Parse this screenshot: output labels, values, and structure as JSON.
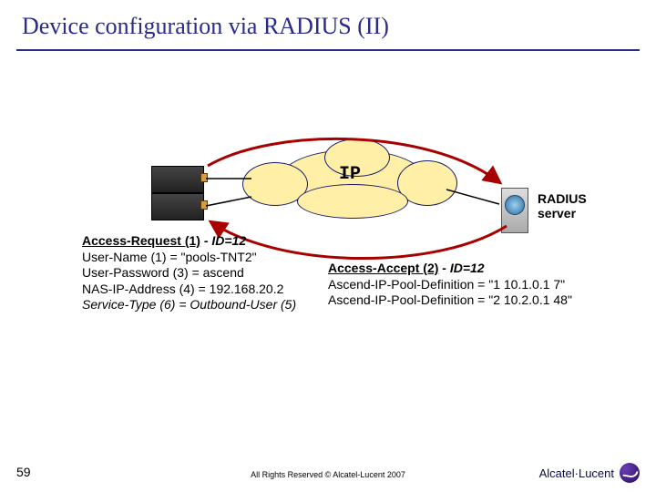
{
  "title": "Device configuration via RADIUS (II)",
  "cloud_label": "IP",
  "server_label": "RADIUS\nserver",
  "request": {
    "header_main": "Access-Request (1)",
    "header_id": " - ID=12",
    "lines": [
      "User-Name (1) = \"pools-TNT2\"",
      "User-Password (3) = ascend",
      "NAS-IP-Address (4) = 192.168.20.2",
      "Service-Type (6) = Outbound-User (5)"
    ]
  },
  "accept": {
    "header_main": "Access-Accept (2)",
    "header_id": " - ID=12",
    "lines": [
      "Ascend-IP-Pool-Definition = \"1 10.1.0.1 7\"",
      "Ascend-IP-Pool-Definition = \"2 10.2.0.1 48\""
    ]
  },
  "page_number": "59",
  "copyright": "All Rights Reserved © Alcatel-Lucent 2007",
  "brand": "Alcatel·Lucent",
  "colors": {
    "accent": "#2a2a8a",
    "arrow": "#a80000",
    "cloud_fill": "#ffefa7"
  }
}
